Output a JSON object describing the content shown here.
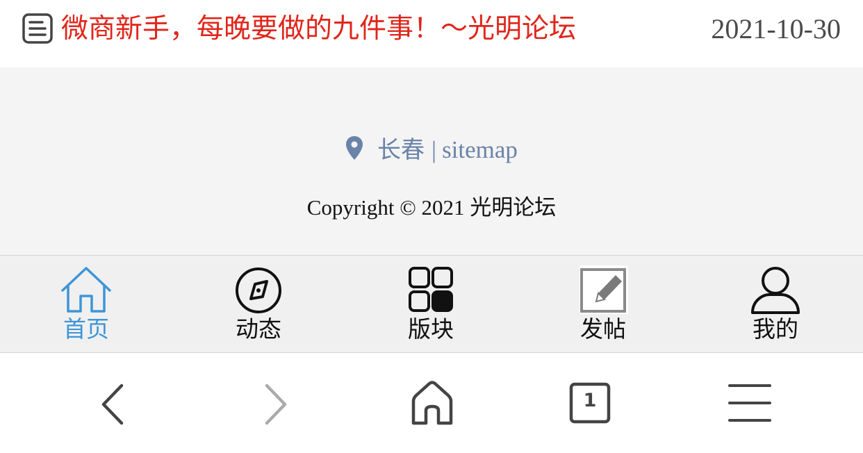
{
  "article": {
    "title": "微商新手，每晚要做的九件事！～光明论坛",
    "date": "2021-10-30",
    "title_color": "#e0261b"
  },
  "footer": {
    "city": "长春",
    "separator": "|",
    "sitemap_label": "sitemap",
    "copyright_prefix": "Copyright © 2021",
    "copyright_site": "光明论坛",
    "link_color": "#6a83a8"
  },
  "tabbar": {
    "active_color": "#3d95d8",
    "items": [
      {
        "label": "首页",
        "icon": "home-icon",
        "active": true
      },
      {
        "label": "动态",
        "icon": "compass-icon",
        "active": false
      },
      {
        "label": "版块",
        "icon": "grid-icon",
        "active": false
      },
      {
        "label": "发帖",
        "icon": "edit-icon",
        "active": false
      },
      {
        "label": "我的",
        "icon": "user-icon",
        "active": false
      }
    ]
  },
  "browser": {
    "tab_count": "1",
    "buttons": [
      "back-icon",
      "forward-icon",
      "home-icon",
      "tabs-icon",
      "menu-icon"
    ]
  }
}
